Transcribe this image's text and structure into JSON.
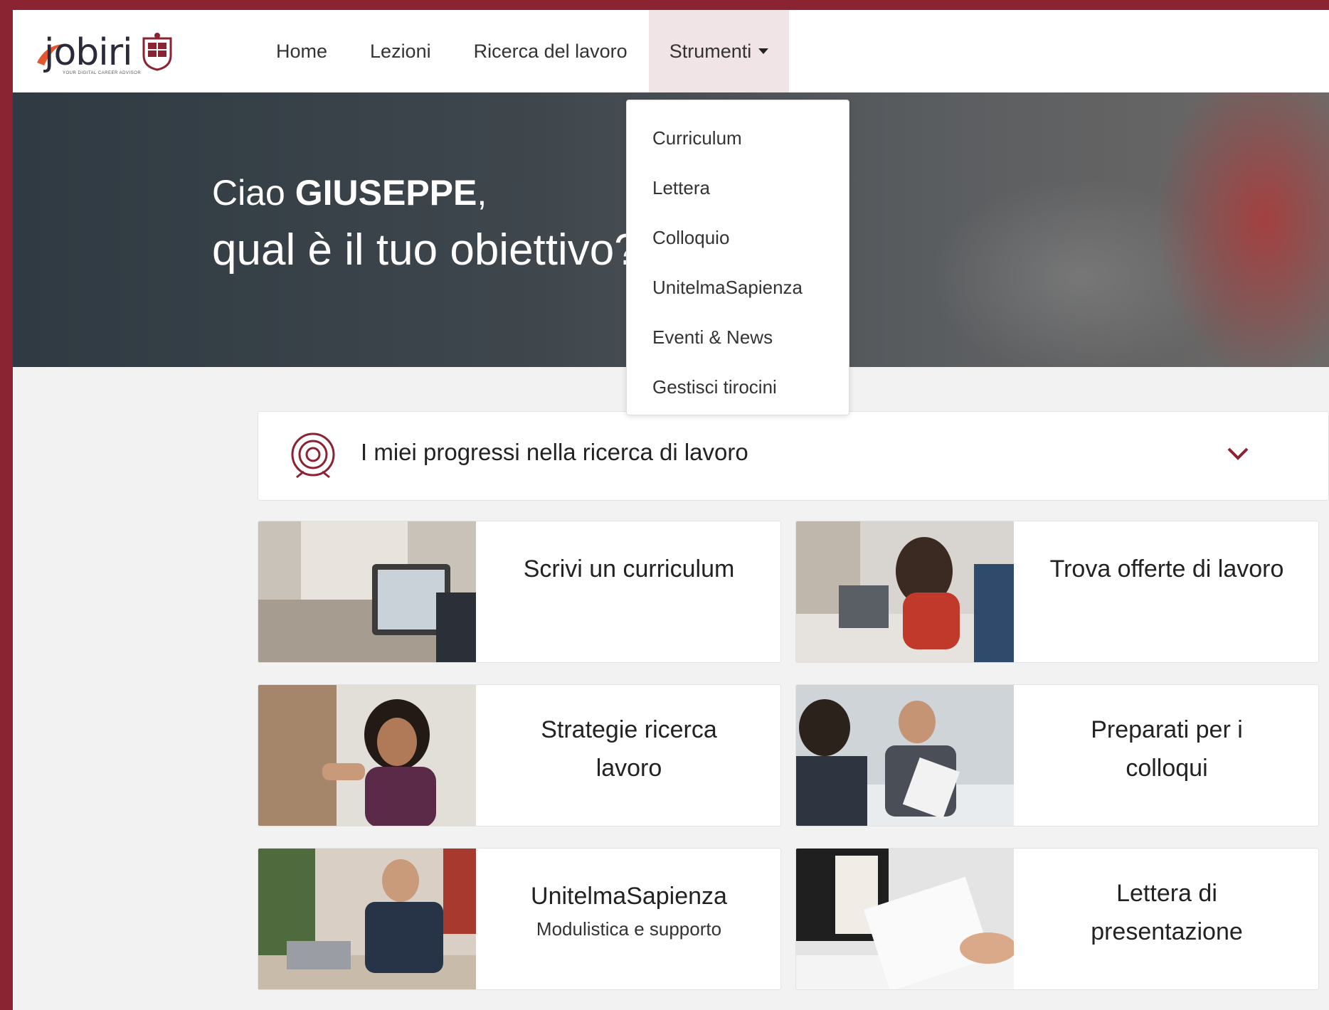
{
  "brand": {
    "name": "jobiri",
    "tagline": "YOUR DIGITAL CAREER ADVISOR"
  },
  "nav": {
    "items": [
      {
        "label": "Home"
      },
      {
        "label": "Lezioni"
      },
      {
        "label": "Ricerca del lavoro"
      },
      {
        "label": "Strumenti"
      }
    ]
  },
  "hero": {
    "greeting_prefix": "Ciao ",
    "user_name": "GIUSEPPE",
    "greeting_suffix": ",",
    "question": "qual è il tuo obiettivo?"
  },
  "dropdown": {
    "items": [
      {
        "label": "Curriculum"
      },
      {
        "label": "Lettera"
      },
      {
        "label": "Colloquio"
      },
      {
        "label": "UnitelmaSapienza"
      },
      {
        "label": "Eventi & News"
      },
      {
        "label": "Gestisci tirocini"
      }
    ]
  },
  "progress": {
    "title": "I miei progressi nella ricerca di lavoro"
  },
  "cards": [
    {
      "title": "Scrivi un curriculum",
      "subtitle": ""
    },
    {
      "title": "Trova offerte di lavoro",
      "subtitle": ""
    },
    {
      "title": "Strategie ricerca lavoro",
      "subtitle": ""
    },
    {
      "title": "Preparati per i colloqui",
      "subtitle": ""
    },
    {
      "title": "UnitelmaSapienza",
      "subtitle": "Modulistica e supporto"
    },
    {
      "title": "Lettera di presentazione",
      "subtitle": ""
    }
  ],
  "colors": {
    "accent": "#8a2433",
    "nav_active_bg": "#f1e4e7",
    "page_bg": "#f2f2f2"
  }
}
